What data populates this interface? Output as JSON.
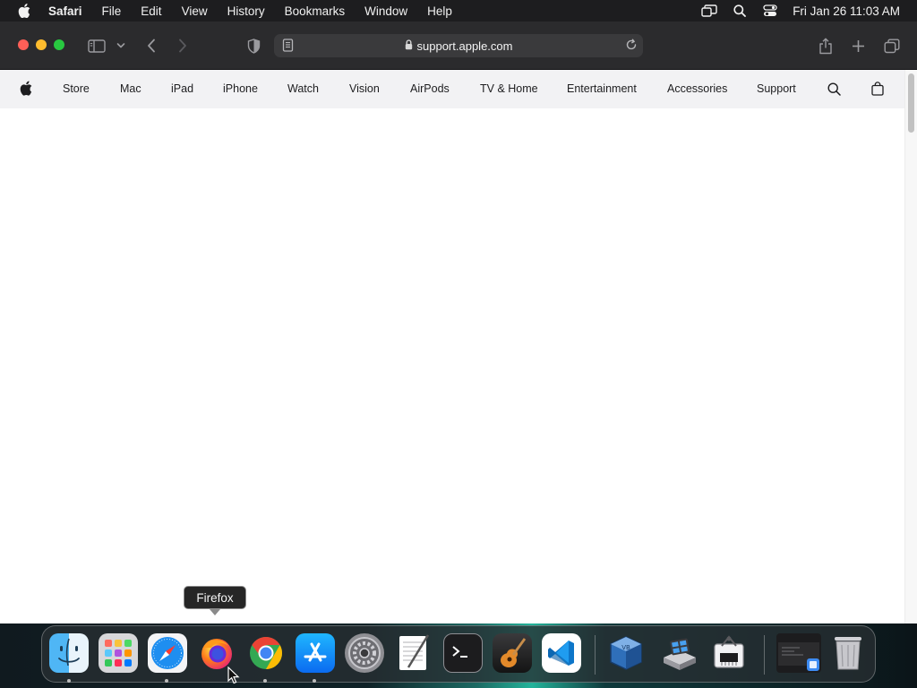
{
  "menubar": {
    "app_name": "Safari",
    "menus": [
      "File",
      "Edit",
      "View",
      "History",
      "Bookmarks",
      "Window",
      "Help"
    ],
    "clock": "Fri Jan 26  11:03 AM",
    "status_icons": [
      "screen-mirroring-icon",
      "spotlight-search-icon",
      "control-center-icon"
    ]
  },
  "browser": {
    "url": "support.apple.com",
    "toolbar_icons": [
      "sidebar-toggle-icon",
      "tab-group-chevron-icon",
      "back-icon",
      "forward-icon",
      "privacy-shield-icon",
      "reader-icon",
      "reload-icon",
      "share-icon",
      "new-tab-icon",
      "tab-overview-icon"
    ]
  },
  "site_nav": {
    "items": [
      "Store",
      "Mac",
      "iPad",
      "iPhone",
      "Watch",
      "Vision",
      "AirPods",
      "TV & Home",
      "Entertainment",
      "Accessories",
      "Support"
    ]
  },
  "dock": {
    "tooltip": "Firefox",
    "apps": [
      "Finder",
      "Launchpad",
      "Safari",
      "Firefox",
      "Chrome",
      "App Store",
      "System Settings",
      "TextEdit",
      "Terminal",
      "GarageBand",
      "Visual Studio Code",
      "VirtualBox",
      "Boot Camp Assistant",
      "System Information",
      "Downloads",
      "Trash"
    ]
  },
  "colors": {
    "menubar_bg": "#1d1d1f",
    "toolbar_bg": "#2b2b2d",
    "address_bg": "#3a3a3c",
    "site_nav_bg": "#f2f2f4",
    "close": "#ff5f57",
    "minimize": "#febc2e",
    "maximize": "#28c840"
  }
}
